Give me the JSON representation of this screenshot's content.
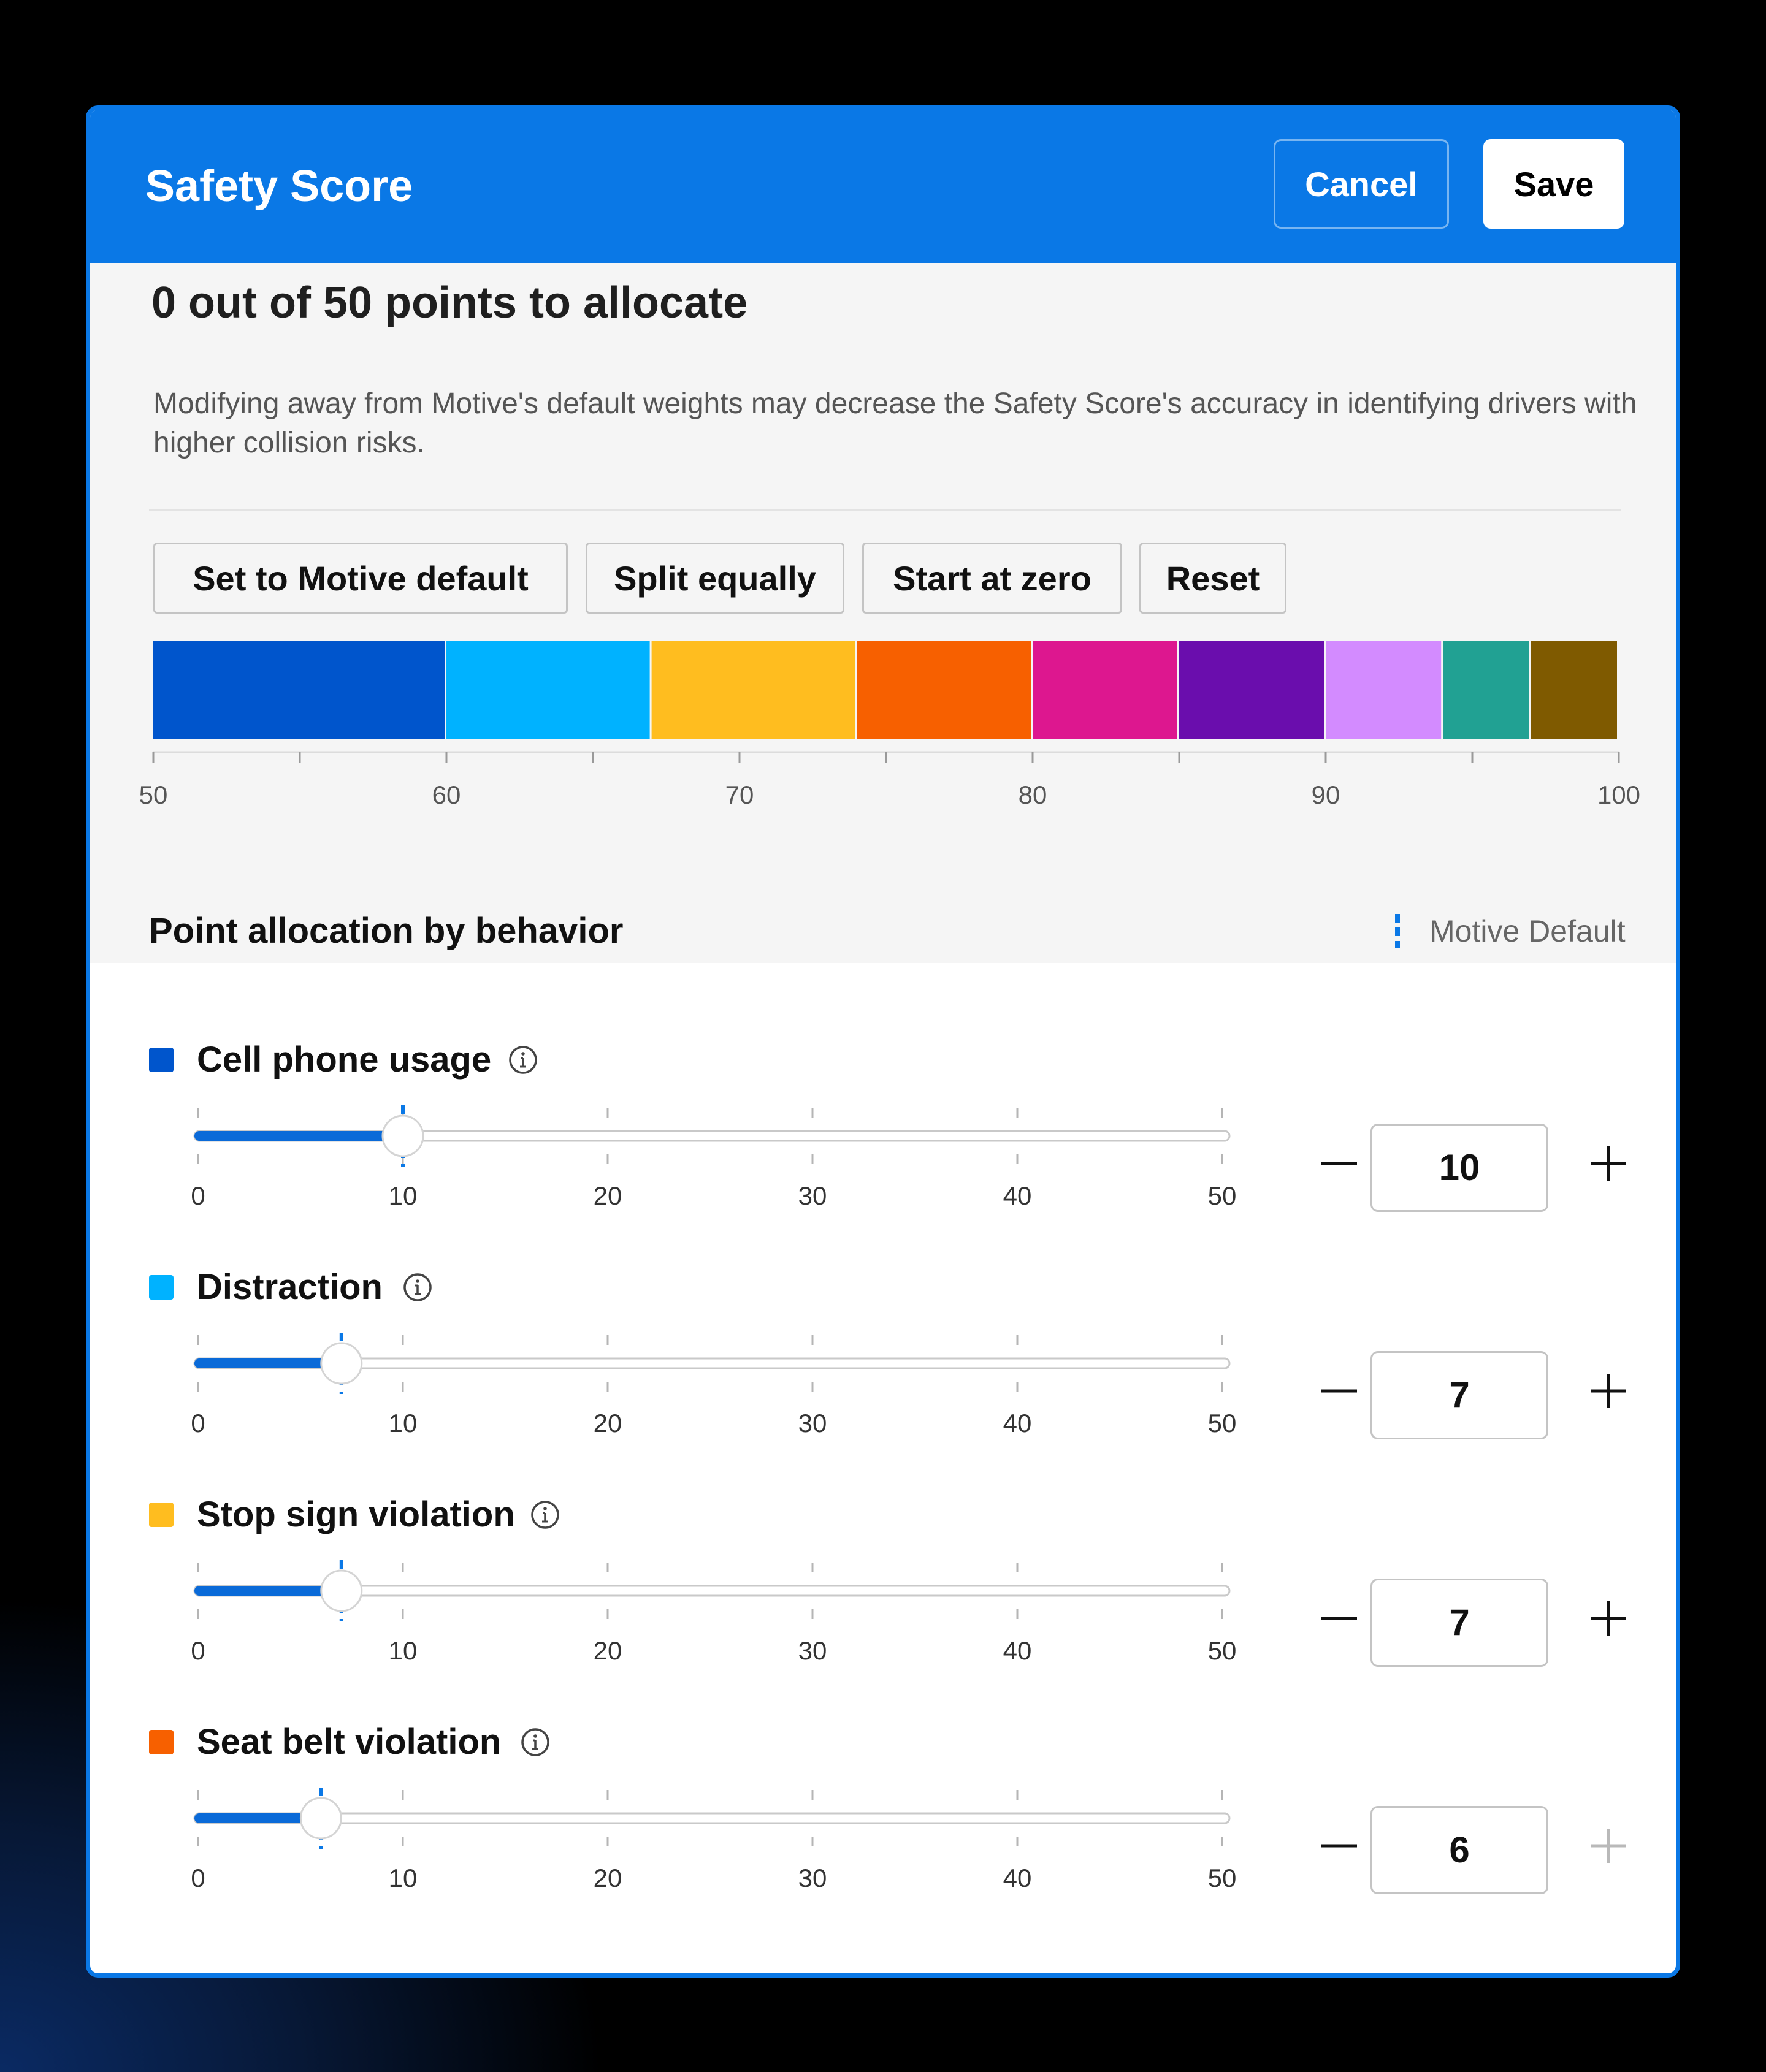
{
  "header": {
    "title": "Safety Score",
    "cancel_label": "Cancel",
    "save_label": "Save"
  },
  "allocation": {
    "title": "0 out of 50 points to allocate",
    "description": "Modifying away from Motive's default weights may decrease the Safety Score's accuracy in identifying drivers with higher collision risks.",
    "buttons": [
      "Set to Motive default",
      "Split equally",
      "Start at zero",
      "Reset"
    ]
  },
  "chart_data": {
    "type": "bar",
    "xlim": [
      50,
      100
    ],
    "tick_labels": [
      "50",
      "60",
      "70",
      "80",
      "90",
      "100"
    ],
    "segments": [
      {
        "value": 10,
        "color": "#0055CC"
      },
      {
        "value": 7,
        "color": "#00B2FF"
      },
      {
        "value": 7,
        "color": "#FFBD1F"
      },
      {
        "value": 6,
        "color": "#F76000"
      },
      {
        "value": 5,
        "color": "#DD178F"
      },
      {
        "value": 5,
        "color": "#6A0DAD"
      },
      {
        "value": 4,
        "color": "#D38BFF"
      },
      {
        "value": 3,
        "color": "#21A193"
      },
      {
        "value": 3,
        "color": "#7F5A00"
      }
    ]
  },
  "behaviors_section": {
    "title": "Point allocation by behavior",
    "legend_label": "Motive Default"
  },
  "slider_scale": {
    "min": 0,
    "max": 50,
    "labels": [
      "0",
      "10",
      "20",
      "30",
      "40",
      "50"
    ]
  },
  "behaviors": [
    {
      "label": "Cell phone usage",
      "value": "10",
      "color": "#0055CC",
      "default": 10,
      "plus_enabled": true
    },
    {
      "label": "Distraction",
      "value": "7",
      "color": "#00B2FF",
      "default": 7,
      "plus_enabled": true
    },
    {
      "label": "Stop sign violation",
      "value": "7",
      "color": "#FFBD1F",
      "default": 7,
      "plus_enabled": true
    },
    {
      "label": "Seat belt violation",
      "value": "6",
      "color": "#F76000",
      "default": 6,
      "plus_enabled": false
    }
  ],
  "icons": {
    "info": "info-circle-icon",
    "minus": "minus-icon",
    "plus": "plus-icon",
    "default_marker": "dashed-line-icon"
  },
  "colors": {
    "accent": "#0A78E6",
    "slider_fill": "#0A6AD8"
  }
}
